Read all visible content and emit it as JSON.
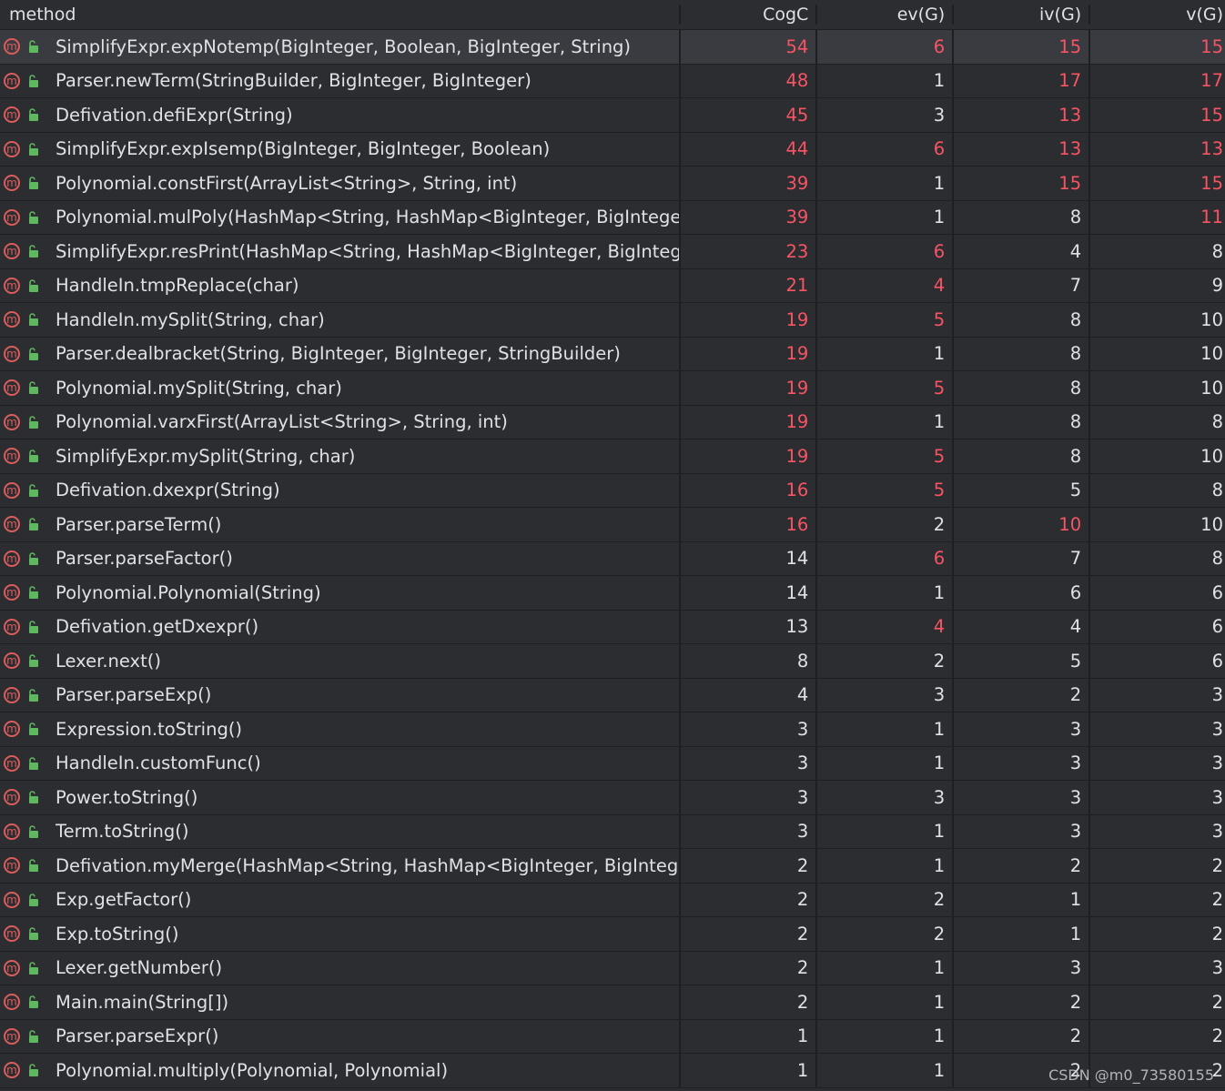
{
  "columns": {
    "method": "method",
    "cogc": "CogC",
    "ev": "ev(G)",
    "iv": "iv(G)",
    "v": "v(G)"
  },
  "rows": [
    {
      "method": "SimplifyExpr.expNotemp(BigInteger, Boolean, BigInteger, String)",
      "cogc": "54",
      "ev": "6",
      "iv": "15",
      "v": "15",
      "red": [
        true,
        true,
        true,
        true
      ]
    },
    {
      "method": "Parser.newTerm(StringBuilder, BigInteger, BigInteger)",
      "cogc": "48",
      "ev": "1",
      "iv": "17",
      "v": "17",
      "red": [
        true,
        false,
        true,
        true
      ]
    },
    {
      "method": "Defivation.defiExpr(String)",
      "cogc": "45",
      "ev": "3",
      "iv": "13",
      "v": "15",
      "red": [
        true,
        false,
        true,
        true
      ]
    },
    {
      "method": "SimplifyExpr.expIsemp(BigInteger, BigInteger, Boolean)",
      "cogc": "44",
      "ev": "6",
      "iv": "13",
      "v": "13",
      "red": [
        true,
        true,
        true,
        true
      ]
    },
    {
      "method": "Polynomial.constFirst(ArrayList<String>, String, int)",
      "cogc": "39",
      "ev": "1",
      "iv": "15",
      "v": "15",
      "red": [
        true,
        false,
        true,
        true
      ]
    },
    {
      "method": "Polynomial.mulPoly(HashMap<String, HashMap<BigInteger, BigInteger>>, H",
      "cogc": "39",
      "ev": "1",
      "iv": "8",
      "v": "11",
      "red": [
        true,
        false,
        false,
        true
      ]
    },
    {
      "method": "SimplifyExpr.resPrint(HashMap<String, HashMap<BigInteger, BigInteger>>)",
      "cogc": "23",
      "ev": "6",
      "iv": "4",
      "v": "8",
      "red": [
        true,
        true,
        false,
        false
      ]
    },
    {
      "method": "HandleIn.tmpReplace(char)",
      "cogc": "21",
      "ev": "4",
      "iv": "7",
      "v": "9",
      "red": [
        true,
        true,
        false,
        false
      ]
    },
    {
      "method": "HandleIn.mySplit(String, char)",
      "cogc": "19",
      "ev": "5",
      "iv": "8",
      "v": "10",
      "red": [
        true,
        true,
        false,
        false
      ]
    },
    {
      "method": "Parser.dealbracket(String, BigInteger, BigInteger, StringBuilder)",
      "cogc": "19",
      "ev": "1",
      "iv": "8",
      "v": "10",
      "red": [
        true,
        false,
        false,
        false
      ]
    },
    {
      "method": "Polynomial.mySplit(String, char)",
      "cogc": "19",
      "ev": "5",
      "iv": "8",
      "v": "10",
      "red": [
        true,
        true,
        false,
        false
      ]
    },
    {
      "method": "Polynomial.varxFirst(ArrayList<String>, String, int)",
      "cogc": "19",
      "ev": "1",
      "iv": "8",
      "v": "8",
      "red": [
        true,
        false,
        false,
        false
      ]
    },
    {
      "method": "SimplifyExpr.mySplit(String, char)",
      "cogc": "19",
      "ev": "5",
      "iv": "8",
      "v": "10",
      "red": [
        true,
        true,
        false,
        false
      ]
    },
    {
      "method": "Defivation.dxexpr(String)",
      "cogc": "16",
      "ev": "5",
      "iv": "5",
      "v": "8",
      "red": [
        true,
        true,
        false,
        false
      ]
    },
    {
      "method": "Parser.parseTerm()",
      "cogc": "16",
      "ev": "2",
      "iv": "10",
      "v": "10",
      "red": [
        true,
        false,
        true,
        false
      ]
    },
    {
      "method": "Parser.parseFactor()",
      "cogc": "14",
      "ev": "6",
      "iv": "7",
      "v": "8",
      "red": [
        false,
        true,
        false,
        false
      ]
    },
    {
      "method": "Polynomial.Polynomial(String)",
      "cogc": "14",
      "ev": "1",
      "iv": "6",
      "v": "6",
      "red": [
        false,
        false,
        false,
        false
      ]
    },
    {
      "method": "Defivation.getDxexpr()",
      "cogc": "13",
      "ev": "4",
      "iv": "4",
      "v": "6",
      "red": [
        false,
        true,
        false,
        false
      ]
    },
    {
      "method": "Lexer.next()",
      "cogc": "8",
      "ev": "2",
      "iv": "5",
      "v": "6",
      "red": [
        false,
        false,
        false,
        false
      ]
    },
    {
      "method": "Parser.parseExp()",
      "cogc": "4",
      "ev": "3",
      "iv": "2",
      "v": "3",
      "red": [
        false,
        false,
        false,
        false
      ]
    },
    {
      "method": "Expression.toString()",
      "cogc": "3",
      "ev": "1",
      "iv": "3",
      "v": "3",
      "red": [
        false,
        false,
        false,
        false
      ]
    },
    {
      "method": "HandleIn.customFunc()",
      "cogc": "3",
      "ev": "1",
      "iv": "3",
      "v": "3",
      "red": [
        false,
        false,
        false,
        false
      ]
    },
    {
      "method": "Power.toString()",
      "cogc": "3",
      "ev": "3",
      "iv": "3",
      "v": "3",
      "red": [
        false,
        false,
        false,
        false
      ]
    },
    {
      "method": "Term.toString()",
      "cogc": "3",
      "ev": "1",
      "iv": "3",
      "v": "3",
      "red": [
        false,
        false,
        false,
        false
      ]
    },
    {
      "method": "Defivation.myMerge(HashMap<String, HashMap<BigInteger, BigInteger>>, H",
      "cogc": "2",
      "ev": "1",
      "iv": "2",
      "v": "2",
      "red": [
        false,
        false,
        false,
        false
      ]
    },
    {
      "method": "Exp.getFactor()",
      "cogc": "2",
      "ev": "2",
      "iv": "1",
      "v": "2",
      "red": [
        false,
        false,
        false,
        false
      ]
    },
    {
      "method": "Exp.toString()",
      "cogc": "2",
      "ev": "2",
      "iv": "1",
      "v": "2",
      "red": [
        false,
        false,
        false,
        false
      ]
    },
    {
      "method": "Lexer.getNumber()",
      "cogc": "2",
      "ev": "1",
      "iv": "3",
      "v": "3",
      "red": [
        false,
        false,
        false,
        false
      ]
    },
    {
      "method": "Main.main(String[])",
      "cogc": "2",
      "ev": "1",
      "iv": "2",
      "v": "2",
      "red": [
        false,
        false,
        false,
        false
      ]
    },
    {
      "method": "Parser.parseExpr()",
      "cogc": "1",
      "ev": "1",
      "iv": "2",
      "v": "2",
      "red": [
        false,
        false,
        false,
        false
      ]
    },
    {
      "method": "Polynomial.multiply(Polynomial, Polynomial)",
      "cogc": "1",
      "ev": "1",
      "iv": "2",
      "v": "2",
      "red": [
        false,
        false,
        false,
        false
      ]
    }
  ],
  "method_icon_letter": "m",
  "icons": {
    "method": "method-icon",
    "visibility": "public-lock-icon",
    "sort": "chevron-down-icon"
  },
  "colors": {
    "highlight": "#f75464",
    "normal": "#dfe1e5",
    "background": "#2b2d30",
    "selected_row": "#393b40"
  },
  "watermark": "CSDN @m0_73580155"
}
